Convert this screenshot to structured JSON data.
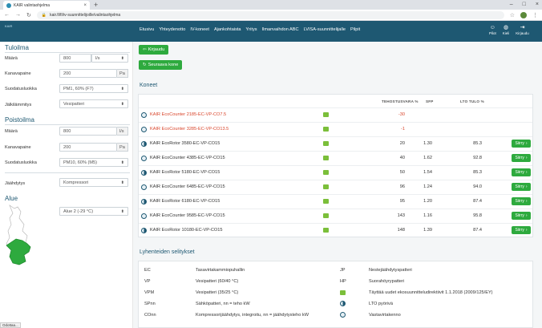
{
  "browser": {
    "tab_title": "KAIR valintaohjelma",
    "url": "kair.fi/fi/iv-suunnittelijoille/valintaohjelma"
  },
  "site": {
    "logo": "KAIR",
    "logo_sub": "Tuotto Suunnittelu",
    "nav": [
      "Etusivu",
      "Yhteydenotto",
      "IV-koneet",
      "Ajankohtaista",
      "Yritys",
      "Ilmanvaihdon ABC",
      "LVISA-suunnittelijalle",
      "Pilpit"
    ],
    "icons": [
      {
        "label": "Pilot",
        "icon": "person-icon"
      },
      {
        "label": "Kieli",
        "icon": "globe-icon"
      },
      {
        "label": "Kirjaudu",
        "icon": "login-icon"
      }
    ]
  },
  "sidebar": {
    "tuloilma": {
      "title": "Tuloilma",
      "maara_label": "Määrä",
      "maara_value": "800",
      "maara_unit": "l/s",
      "kanava_label": "Kanavapaine",
      "kanava_value": "200",
      "kanava_unit": "Pa",
      "suodatus_label": "Suodatusluokka",
      "suodatus_value": "PM1, 60% (F7)",
      "jalki_label": "Jälkilämmitys",
      "jalki_value": "Vesipatteri"
    },
    "poistoilma": {
      "title": "Poistoilma",
      "maara_label": "Määrä",
      "maara_value": "800",
      "maara_unit": "l/s",
      "kanava_label": "Kanavapaine",
      "kanava_value": "200",
      "kanava_unit": "Pa",
      "suodatus_label": "Suodatusluokka",
      "suodatus_value": "PM10, 60% (M5)"
    },
    "jaahdytys_label": "Jäähdytys",
    "jaahdytys_value": "Kompressori",
    "alue": {
      "title": "Alue",
      "value": "Alue 2 (-29 °C)"
    }
  },
  "content": {
    "buttons": {
      "back": "Kirjaudu",
      "next": "Seuraava kone"
    },
    "koneet_title": "Koneet",
    "headers": [
      "TEHOSTUSVARA %",
      "SFP",
      "LTO TULO %"
    ],
    "go_label": "Siirry",
    "rows": [
      {
        "name": "KAIR EcoCounter 2185-EC-VP-CO7.5",
        "red": true,
        "v1": "-30",
        "v2": "",
        "v3": "",
        "go": false
      },
      {
        "name": "KAIR EcoCounter 3285-EC-VP-CO13.5",
        "red": true,
        "v1": "-1",
        "v2": "",
        "v3": "",
        "go": false
      },
      {
        "name": "KAIR EcoRotor 3580-EC-VP-CO15",
        "red": false,
        "v1": "20",
        "v2": "1.30",
        "v3": "85.3",
        "go": true
      },
      {
        "name": "KAIR EcoCounter 4385-EC-VP-CO15",
        "red": false,
        "v1": "40",
        "v2": "1.62",
        "v3": "92.8",
        "go": true
      },
      {
        "name": "KAIR EcoRotor 5180-EC-VP-CO15",
        "red": false,
        "v1": "50",
        "v2": "1.54",
        "v3": "85.3",
        "go": true
      },
      {
        "name": "KAIR EcoCounter 6485-EC-VP-CO15",
        "red": false,
        "v1": "96",
        "v2": "1.24",
        "v3": "94.0",
        "go": true
      },
      {
        "name": "KAIR EcoRotor 6180-EC-VP-CO15",
        "red": false,
        "v1": "95",
        "v2": "1.20",
        "v3": "87.4",
        "go": true
      },
      {
        "name": "KAIR EcoCounter 9585-EC-VP-CO15",
        "red": false,
        "v1": "143",
        "v2": "1.16",
        "v3": "95.8",
        "go": true
      },
      {
        "name": "KAIR EcoRotor 10180-EC-VP-CO15",
        "red": false,
        "v1": "148",
        "v2": "1.39",
        "v3": "87.4",
        "go": true
      }
    ],
    "lyhenteet_title": "Lyhenteiden selitykset",
    "legend_left": [
      {
        "k": "EC",
        "v": "Tasavirtakammiopuhallin"
      },
      {
        "k": "VP",
        "v": "Vesipatteri (60/40 °C)"
      },
      {
        "k": "VPM",
        "v": "Vesipatteri (35/25 °C)"
      },
      {
        "k": "SPnn",
        "v": "Sähköpatteri, nn = teho kW"
      },
      {
        "k": "COnn",
        "v": "Kompressorijäähdytys, integroitu, nn = jäähdytysteho kW"
      }
    ],
    "legend_right": [
      {
        "k": "JP",
        "v": "Nestejäähdytyspatteri"
      },
      {
        "k": "HP",
        "v": "Suorahöyrypatteri"
      },
      {
        "k": "",
        "v": "Täyttää uudet ekosuunnitteludirektiivit 1.1.2018 (2009/125/EY)"
      },
      {
        "k": "",
        "v": "LTO pyörivä"
      },
      {
        "k": "",
        "v": "Vastavirtakenno"
      }
    ]
  },
  "status_text": "Odottaa..."
}
